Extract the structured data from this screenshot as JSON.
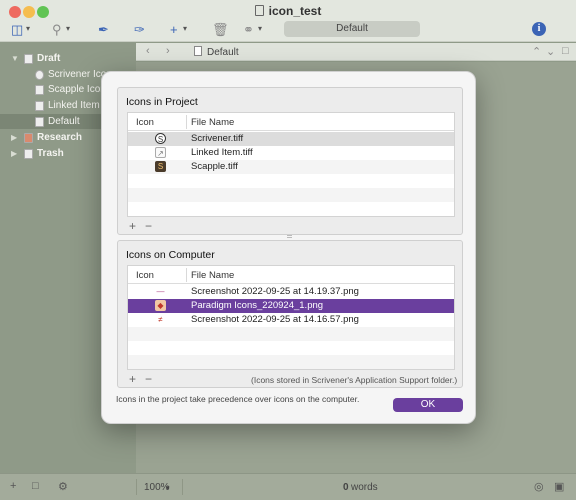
{
  "window": {
    "title": "icon_test",
    "toolbar_field": "Default",
    "info_label": "i"
  },
  "binder": {
    "items": [
      {
        "label": "Draft",
        "bold": true
      },
      {
        "label": "Scrivener Icon"
      },
      {
        "label": "Scapple Icon"
      },
      {
        "label": "Linked Item"
      },
      {
        "label": "Default",
        "selected": true
      },
      {
        "label": "Research",
        "bold": true
      },
      {
        "label": "Trash",
        "bold": true
      }
    ]
  },
  "editor": {
    "header_title": "Default"
  },
  "footer": {
    "zoom": "100%",
    "word_count": "0",
    "words_label": "words"
  },
  "dialog": {
    "project_section": {
      "title": "Icons in Project",
      "col_icon": "Icon",
      "col_file": "File Name",
      "rows": [
        {
          "file": "Scrivener.tiff",
          "icon": "scrivener-icon"
        },
        {
          "file": "Linked Item.tiff",
          "icon": "linked-item-icon"
        },
        {
          "file": "Scapple.tiff",
          "icon": "scapple-icon"
        }
      ]
    },
    "computer_section": {
      "title": "Icons on Computer",
      "col_icon": "Icon",
      "col_file": "File Name",
      "rows": [
        {
          "file": "Screenshot 2022-09-25 at 14.19.37.png",
          "icon": "screenshot-icon"
        },
        {
          "file": "Paradigm Icons_220924_1.png",
          "icon": "paradigm-icon"
        },
        {
          "file": "Screenshot 2022-09-25 at 14.16.57.png",
          "icon": "screenshot-icon"
        }
      ],
      "support_note": "(Icons stored in Scrivener's Application Support folder.)"
    },
    "add_symbol": "+",
    "remove_symbol": "−",
    "precedence_note": "Icons in the project take precedence over icons on the computer.",
    "ok_label": "OK",
    "colors": {
      "selection": "#6a3f9e"
    }
  }
}
